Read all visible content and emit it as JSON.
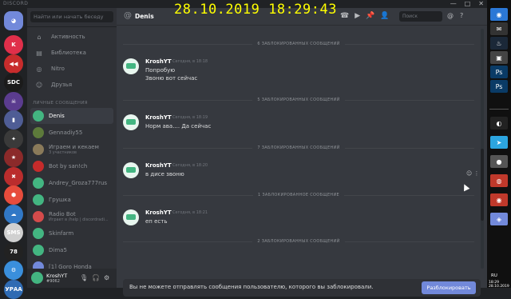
{
  "overlay": {
    "datetime": "28.10.2019 18:29:43"
  },
  "window": {
    "brand": "DISCORD",
    "controls": [
      "—",
      "□",
      "✕"
    ]
  },
  "rail": {
    "servers": [
      {
        "label": "K",
        "color": "#e02f4a"
      },
      {
        "label": "◀◀",
        "color": "#c82c2c"
      },
      {
        "label": "SDC",
        "color": "#1b1b1b"
      },
      {
        "label": "☠",
        "color": "#5b3c8f"
      },
      {
        "label": "▮",
        "color": "#4f5d95"
      },
      {
        "label": "✦",
        "color": "#3a3a3a"
      },
      {
        "label": "★",
        "color": "#8b2a2a"
      },
      {
        "label": "✖",
        "color": "#ba2d2d"
      },
      {
        "label": "⬢",
        "color": "#e74c3c"
      },
      {
        "label": "☁",
        "color": "#3178c6"
      },
      {
        "label": "SMS",
        "color": "#d0d0d0"
      },
      {
        "label": "78",
        "color": "#222222"
      },
      {
        "label": "⚙",
        "color": "#3a8fdc"
      },
      {
        "label": "УРАА",
        "color": "#2f6bb3"
      }
    ]
  },
  "sidebar": {
    "search_placeholder": "Найти или начать беседу",
    "nav": [
      {
        "label": "Активность",
        "icon": "⌂"
      },
      {
        "label": "Библиотека",
        "icon": "▤"
      },
      {
        "label": "Nitro",
        "icon": "◎"
      },
      {
        "label": "Друзья",
        "icon": "☺"
      }
    ],
    "section_title": "ЛИЧНЫЕ СООБЩЕНИЯ",
    "dms": [
      {
        "name": "Denis",
        "sub": "",
        "color": "#43b581",
        "active": true
      },
      {
        "name": "Gennadiy55",
        "sub": "",
        "color": "#5d7a3b",
        "active": false
      },
      {
        "name": "Играем и кекаем",
        "sub": "3 участников",
        "color": "#8a7a5a",
        "active": false
      },
      {
        "name": "Bot by san!ch",
        "sub": "",
        "color": "#c52b2b",
        "active": false
      },
      {
        "name": "Andrey_Groza777rus",
        "sub": "",
        "color": "#43b581",
        "active": false
      },
      {
        "name": "Грушка",
        "sub": "",
        "color": "#43b581",
        "active": false
      },
      {
        "name": "Radio Bot",
        "sub": "Играет в /help | discordradi...",
        "color": "#d44b4b",
        "active": false
      },
      {
        "name": "Skinfarm",
        "sub": "",
        "color": "#43b581",
        "active": false
      },
      {
        "name": "Dima5",
        "sub": "",
        "color": "#43b581",
        "active": false
      },
      {
        "name": "[1] Goro Honda",
        "sub": "",
        "color": "#7289da",
        "active": false
      }
    ],
    "user": {
      "name": "KroshYT",
      "tag": "#9062"
    }
  },
  "chat": {
    "header": {
      "title": "Denis",
      "search_placeholder": "Поиск"
    },
    "blocked_dividers": [
      "6 ЗАБЛОКИРОВАННЫХ СООБЩЕНИЙ",
      "5 ЗАБЛОКИРОВАННЫХ СООБЩЕНИЙ",
      "7 ЗАБЛОКИРОВАННЫХ СООБЩЕНИЙ",
      "1 ЗАБЛОКИРОВАННОЕ СООБЩЕНИЕ",
      "2 ЗАБЛОКИРОВАННЫХ СООБЩЕНИЙ"
    ],
    "messages": [
      {
        "author": "KroshYT",
        "time": "Сегодня, в 18:18",
        "lines": [
          "Попробую",
          "Звоню вот сейчас"
        ]
      },
      {
        "author": "KroshYT",
        "time": "Сегодня, в 18:19",
        "lines": [
          "Норм ава.... Да сейчас"
        ]
      },
      {
        "author": "KroshYT",
        "time": "Сегодня, в 18:20",
        "lines": [
          "в дисе звоню"
        ]
      },
      {
        "author": "KroshYT",
        "time": "Сегодня, в 18:21",
        "lines": [
          "еп есть"
        ]
      }
    ],
    "blocked_notice": "Вы не можете отправлять сообщения пользователю, которого вы заблокировали.",
    "unblock_label": "Разблокировать"
  },
  "taskbar": {
    "apps": [
      {
        "icon": "◉",
        "color": "#2b78d6"
      },
      {
        "icon": "✉",
        "color": "#333333"
      },
      {
        "icon": "♨",
        "color": "#1b2838"
      },
      {
        "icon": "▣",
        "color": "#444444"
      },
      {
        "icon": "Ps",
        "color": "#0a3b66"
      },
      {
        "icon": "Ps",
        "color": "#0a3b66"
      },
      {
        "icon": "◐",
        "color": "#222222"
      },
      {
        "icon": "➤",
        "color": "#2ca5e0"
      },
      {
        "icon": "●",
        "color": "#555555"
      },
      {
        "icon": "◍",
        "color": "#c0392b"
      },
      {
        "icon": "◉",
        "color": "#c0392b"
      },
      {
        "icon": "◈",
        "color": "#7289da"
      }
    ],
    "lang": "RU",
    "time": "18:29",
    "date": "28.10.2019"
  }
}
